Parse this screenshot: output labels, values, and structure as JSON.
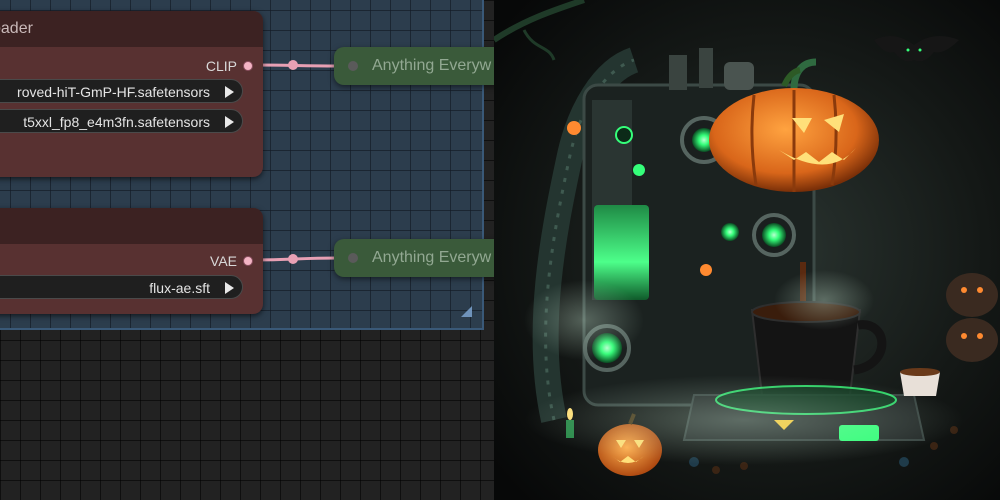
{
  "clip_node": {
    "title": "oader",
    "output_label": "CLIP",
    "widgets": [
      {
        "value": "roved-hiT-GmP-HF.safetensors"
      },
      {
        "value": "t5xxl_fp8_e4m3fn.safetensors"
      }
    ]
  },
  "vae_node": {
    "title": "",
    "output_label": "VAE",
    "widgets": [
      {
        "value": "flux-ae.sft"
      }
    ]
  },
  "anything_nodes": [
    {
      "title": "Anything Everyw"
    },
    {
      "title": "Anything Everyw"
    }
  ],
  "colors": {
    "canvas_bg": "#222222",
    "group_bg": "#2c3d4d",
    "loader_node_bg": "#583131",
    "anything_node_bg": "#3a5a3a",
    "link_color": "#e8a0b4",
    "pumpkin_orange": "#e87a1e",
    "machine_glow": "#35ff7a"
  },
  "image": {
    "subject": "halloween-coffee-machine-with-pumpkin"
  }
}
